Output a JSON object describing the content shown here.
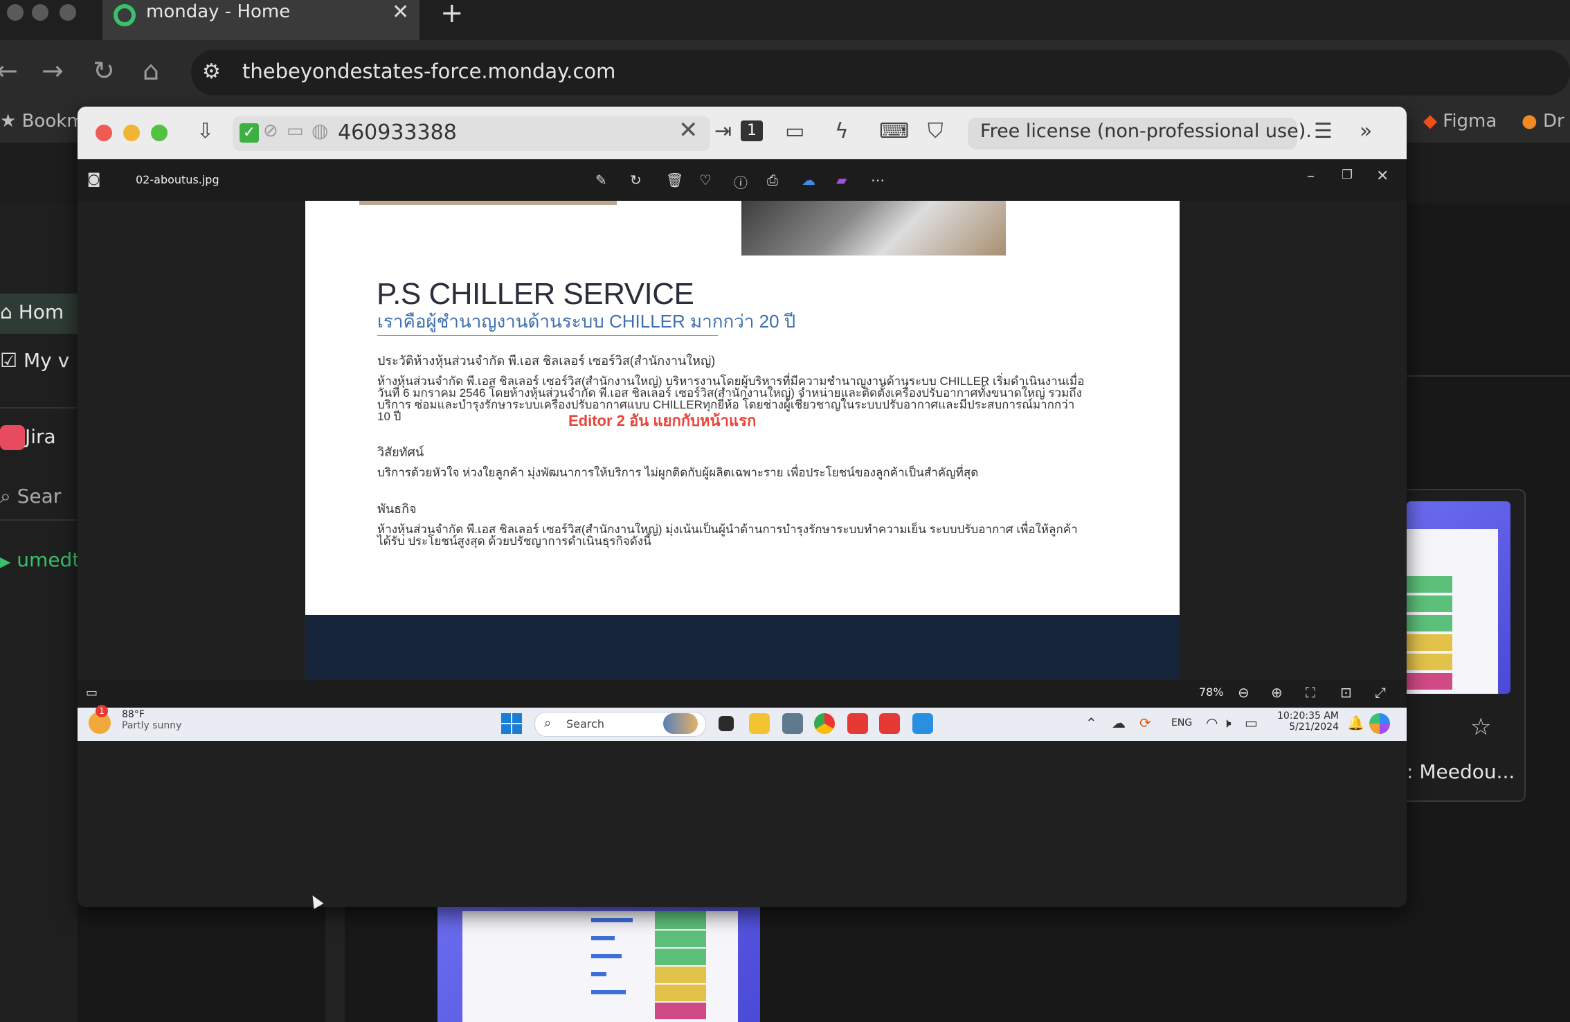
{
  "browser": {
    "tab_title": "monday - Home",
    "tab_close": "✕",
    "new_tab": "+",
    "url": "thebeyondestates-force.monday.com",
    "bookmarks": [
      {
        "label": "Bookm",
        "icon": "star-icon"
      },
      {
        "label": "Figma",
        "icon": "figma-icon"
      },
      {
        "label": "Dr",
        "icon": "dribbble-icon"
      }
    ]
  },
  "monday": {
    "sidebar": {
      "home": "Hom",
      "my_work": "My v",
      "app": "Jira",
      "search": "Sear",
      "workspace": "umedt"
    },
    "card_label": ": Meedou..."
  },
  "remote": {
    "session_id": "460933388",
    "license": "Free license (non-professional use).",
    "badge_count": "1"
  },
  "viewer": {
    "file_name": "02-aboutus.jpg",
    "zoom": "78%"
  },
  "document": {
    "title": "P.S CHILLER SERVICE",
    "subtitle": "เราคือผู้ชำนาญงานด้านระบบ CHILLER มากกว่า 20 ปี",
    "history_heading": "ประวัติห้างหุ้นส่วนจำกัด พี.เอส ชิลเลอร์ เซอร์วิส(สำนักงานใหญ่)",
    "history_body": "ห้างหุ้นส่วนจำกัด พี.เอส ชิลเลอร์ เซอร์วิส(สำนักงานใหญ่) บริหารงานโดยผู้บริหารที่มีความชำนาญงานด้านระบบ CHILLER เริ่มดำเนินงานเมื่อ วันที่ 6 มกราคม 2546 โดยห้างหุ้นส่วนจำกัด พี.เอส ชิลเลอร์ เซอร์วิส(สำนักงานใหญ่) จำหน่ายและติดตั้งเครื่องปรับอากาศทั้งขนาดใหญ่ รวมถึงบริการ ซ่อมและบำรุงรักษาระบบเครื่องปรับอากาศแบบ CHILLERทุกยี่ห้อ โดยช่างผู้เชี่ยวชาญในระบบปรับอากาศและมีประสบการณ์มากกว่า 10 ปี",
    "editor_note": "Editor 2 อัน แยกกับหน้าแรก",
    "vision_heading": "วิสัยทัศน์",
    "vision_body": "บริการด้วยหัวใจ ห่วงใยลูกค้า มุ่งพัฒนาการให้บริการ ไม่ผูกติดกับผู้ผลิตเฉพาะราย เพื่อประโยชน์ของลูกค้าเป็นสำคัญที่สุด",
    "mission_heading": "พันธกิจ",
    "mission_body": "ห้างหุ้นส่วนจำกัด พี.เอส ชิลเลอร์ เซอร์วิส(สำนักงานใหญ่) มุ่งเน้นเป็นผู้นำด้านการบำรุงรักษาระบบทำความเย็น ระบบปรับอากาศ เพื่อให้ลูกค้าได้รับ ประโยชน์สูงสุด ด้วยปรัชญาการดำเนินธุรกิจดังนี้"
  },
  "taskbar": {
    "weather_temp": "88°F",
    "weather_desc": "Partly sunny",
    "weather_badge": "1",
    "search_label": "Search",
    "language": "ENG",
    "time": "10:20:35 AM",
    "date": "5/21/2024"
  },
  "colors": {
    "monday_green": "#37c26b",
    "editor_red": "#e8443a",
    "subtitle_blue": "#3d6fb0",
    "doc_footer_navy": "#16243a"
  }
}
